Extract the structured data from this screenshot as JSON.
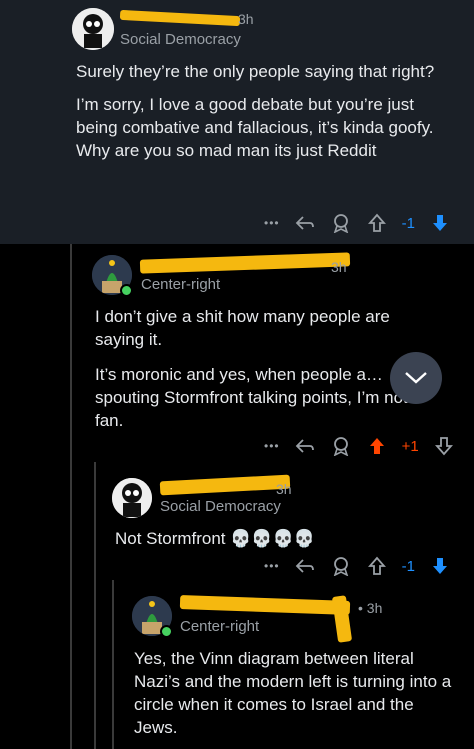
{
  "comments": [
    {
      "time_suffix": "3h",
      "flair": "Social Democracy",
      "paragraphs": [
        "Surely they’re the only people saying that right?",
        "I’m sorry, I love a good debate but you’re just being combative and fallacious, it’s kinda goofy. Why are you so mad man its just Reddit"
      ],
      "vote": "-1"
    },
    {
      "time_suffix": "3h",
      "flair": "Center-right",
      "paragraphs": [
        "I don’t give a shit how many people are saying it.",
        "It’s moronic and yes, when people a… spouting Stormfront talking points, I’m not a fan."
      ],
      "vote": "+1"
    },
    {
      "time_suffix": "3h",
      "flair": "Social Democracy",
      "paragraphs": [
        "Not Stormfront 💀💀💀💀"
      ],
      "vote": "-1"
    },
    {
      "time_suffix": "• 3h",
      "flair": "Center-right",
      "paragraphs": [
        "Yes, the Vinn diagram between literal Nazi’s and the modern left is turning into a circle when it comes to Israel and the Jews."
      ]
    }
  ],
  "actions": {
    "more_glyph": "•••"
  },
  "colors": {
    "upvote": "#ff4500",
    "downvote": "#1e90ff",
    "redaction": "#f5b80f",
    "online": "#46d160"
  },
  "icons": [
    "reply-icon",
    "award-icon",
    "upvote-icon",
    "downvote-icon",
    "more-icon",
    "chevron-down-icon"
  ]
}
